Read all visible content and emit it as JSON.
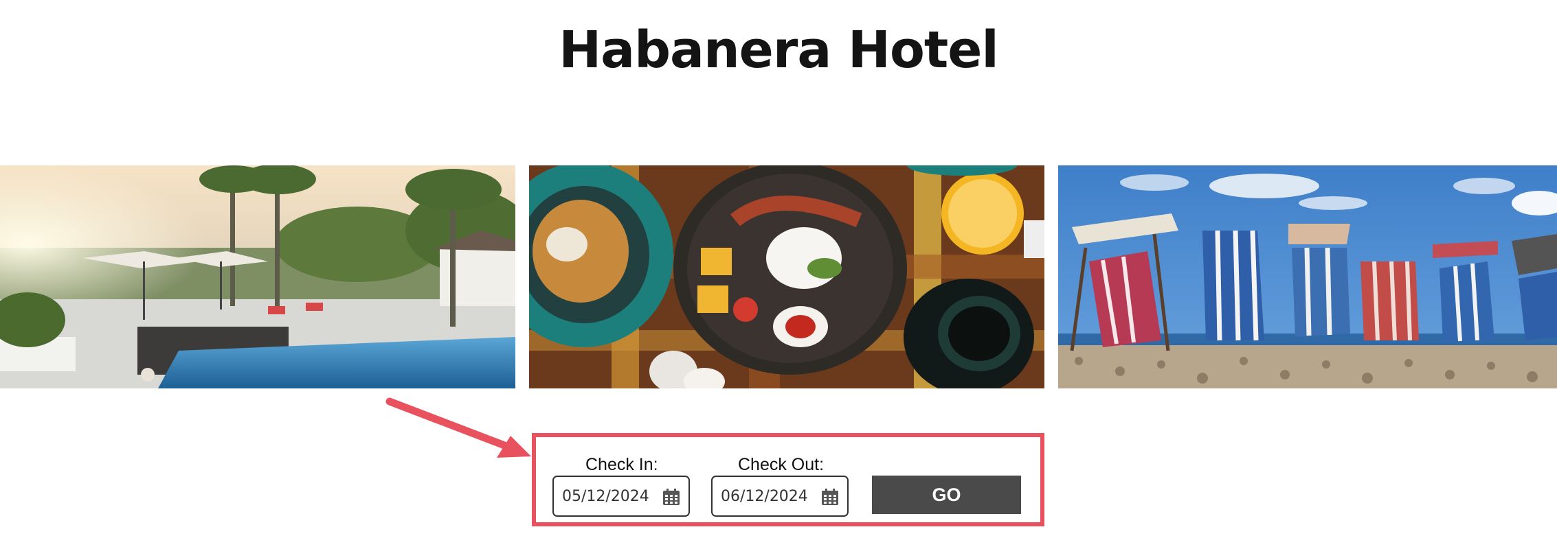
{
  "page": {
    "title": "Habanera Hotel"
  },
  "gallery": {
    "images": [
      {
        "subject": "pool",
        "alt": "Hotel pool with palm trees at sunset"
      },
      {
        "subject": "breakfast",
        "alt": "Breakfast dishes on a wooden table"
      },
      {
        "subject": "beach",
        "alt": "Striped deck chairs on a pebble beach"
      }
    ]
  },
  "booking": {
    "check_in_label": "Check In:",
    "check_in_value": "05/12/2024",
    "check_out_label": "Check Out:",
    "check_out_value": "06/12/2024",
    "go_label": "GO"
  },
  "colors": {
    "highlight": "#e8525e",
    "button_bg": "#4a4a4a",
    "title_text": "#141414"
  },
  "icons": {
    "calendar": "calendar-icon",
    "arrow": "arrow-icon"
  }
}
